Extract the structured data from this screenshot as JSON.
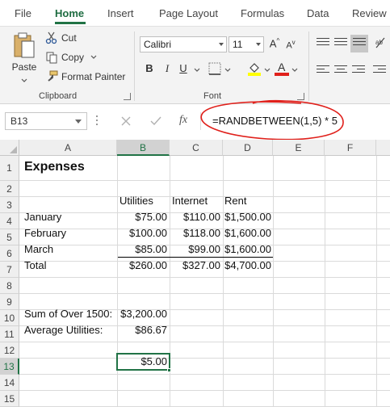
{
  "ribbon_tabs": [
    "File",
    "Home",
    "Insert",
    "Page Layout",
    "Formulas",
    "Data",
    "Review"
  ],
  "active_tab": "Home",
  "clipboard": {
    "paste": "Paste",
    "cut": "Cut",
    "copy": "Copy",
    "format_painter": "Format Painter",
    "group_label": "Clipboard"
  },
  "font": {
    "name": "Calibri",
    "size": "11",
    "grow": "A",
    "shrink": "A",
    "bold": "B",
    "italic": "I",
    "underline": "U",
    "font_color_letter": "A",
    "group_label": "Font"
  },
  "formula_bar": {
    "name_box": "B13",
    "fx": "fx",
    "formula": "=RANDBETWEEN(1,5) * 5"
  },
  "columns": [
    "A",
    "B",
    "C",
    "D",
    "E",
    "F"
  ],
  "rows": [
    "1",
    "2",
    "3",
    "4",
    "5",
    "6",
    "7",
    "8",
    "9",
    "10",
    "11",
    "12",
    "13",
    "14",
    "15"
  ],
  "sheet": {
    "title": "Expenses",
    "headers": [
      "Utilities",
      "Internet",
      "Rent"
    ],
    "data_rows": [
      {
        "label": "January",
        "values": [
          "$75.00",
          "$110.00",
          "$1,500.00"
        ]
      },
      {
        "label": "February",
        "values": [
          "$100.00",
          "$118.00",
          "$1,600.00"
        ]
      },
      {
        "label": "March",
        "values": [
          "$85.00",
          "$99.00",
          "$1,600.00"
        ]
      },
      {
        "label": "Total",
        "values": [
          "$260.00",
          "$327.00",
          "$4,700.00"
        ]
      }
    ],
    "sum_label": "Sum of Over 1500:",
    "sum_value": "$3,200.00",
    "avg_label": "Average Utilities:",
    "avg_value": "$86.67",
    "selected_value": "$5.00"
  },
  "colors": {
    "accent": "#217346",
    "annotation": "#e0201b"
  }
}
